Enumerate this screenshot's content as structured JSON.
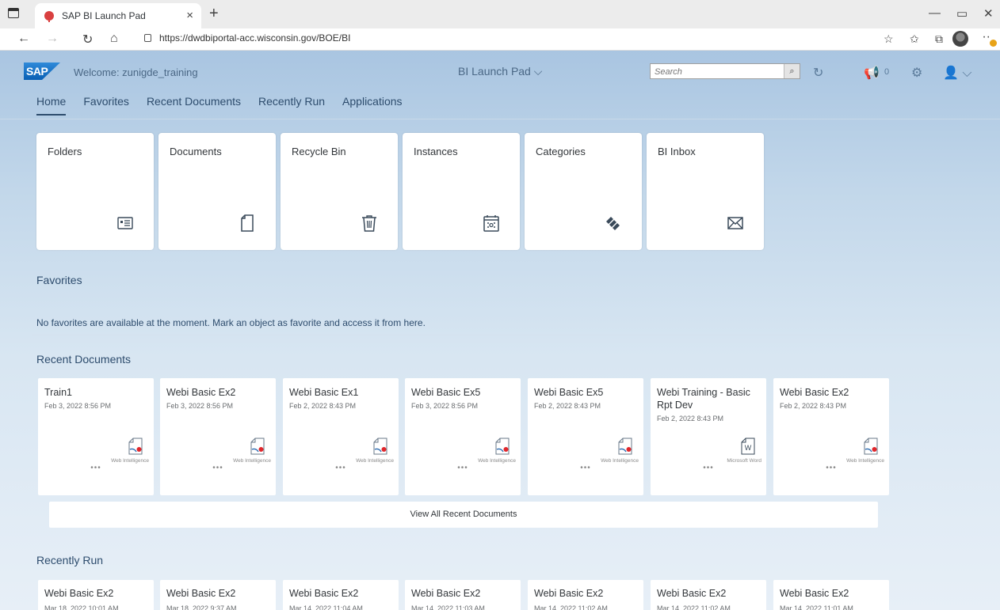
{
  "browser": {
    "tab_title": "SAP BI Launch Pad",
    "url": "https://dwdbiportal-acc.wisconsin.gov/BOE/BI"
  },
  "shell": {
    "welcome": "Welcome: zunigde_training",
    "title": "BI Launch Pad",
    "search_placeholder": "Search",
    "notification_count": "0"
  },
  "tabs": [
    "Home",
    "Favorites",
    "Recent Documents",
    "Recently Run",
    "Applications"
  ],
  "tiles": [
    {
      "label": "Folders",
      "icon": "folder-details-icon"
    },
    {
      "label": "Documents",
      "icon": "document-icon"
    },
    {
      "label": "Recycle Bin",
      "icon": "trash-icon"
    },
    {
      "label": "Instances",
      "icon": "calendar-icon"
    },
    {
      "label": "Categories",
      "icon": "categories-icon"
    },
    {
      "label": "BI Inbox",
      "icon": "envelope-icon"
    }
  ],
  "favorites": {
    "title": "Favorites",
    "empty_message": "No favorites are available at the moment. Mark an object as favorite and access it from here."
  },
  "recent_documents": {
    "title": "Recent Documents",
    "view_all": "View All Recent Documents",
    "more": "•••",
    "items": [
      {
        "name": "Train1",
        "date": "Feb 3, 2022 8:56 PM",
        "type": "Web Intelligence"
      },
      {
        "name": "Webi Basic Ex2",
        "date": "Feb 3, 2022 8:56 PM",
        "type": "Web Intelligence"
      },
      {
        "name": "Webi Basic Ex1",
        "date": "Feb 2, 2022 8:43 PM",
        "type": "Web Intelligence"
      },
      {
        "name": "Webi Basic Ex5",
        "date": "Feb 3, 2022 8:56 PM",
        "type": "Web Intelligence"
      },
      {
        "name": "Webi Basic Ex5",
        "date": "Feb 2, 2022 8:43 PM",
        "type": "Web Intelligence"
      },
      {
        "name": "Webi Training - Basic Rpt Dev",
        "date": "Feb 2, 2022 8:43 PM",
        "type": "Microsoft Word"
      },
      {
        "name": "Webi Basic Ex2",
        "date": "Feb 2, 2022 8:43 PM",
        "type": "Web Intelligence"
      }
    ]
  },
  "recently_run": {
    "title": "Recently Run",
    "items": [
      {
        "name": "Webi Basic Ex2",
        "date": "Mar 18, 2022 10:01 AM"
      },
      {
        "name": "Webi Basic Ex2",
        "date": "Mar 18, 2022 9:37 AM"
      },
      {
        "name": "Webi Basic Ex2",
        "date": "Mar 14, 2022 11:04 AM"
      },
      {
        "name": "Webi Basic Ex2",
        "date": "Mar 14, 2022 11:03 AM"
      },
      {
        "name": "Webi Basic Ex2",
        "date": "Mar 14, 2022 11:02 AM"
      },
      {
        "name": "Webi Basic Ex2",
        "date": "Mar 14, 2022 11:02 AM"
      },
      {
        "name": "Webi Basic Ex2",
        "date": "Mar 14, 2022 11:01 AM"
      }
    ]
  },
  "colors": {
    "accent": "#2d4c6d",
    "webi_dot": "#e0262b"
  }
}
